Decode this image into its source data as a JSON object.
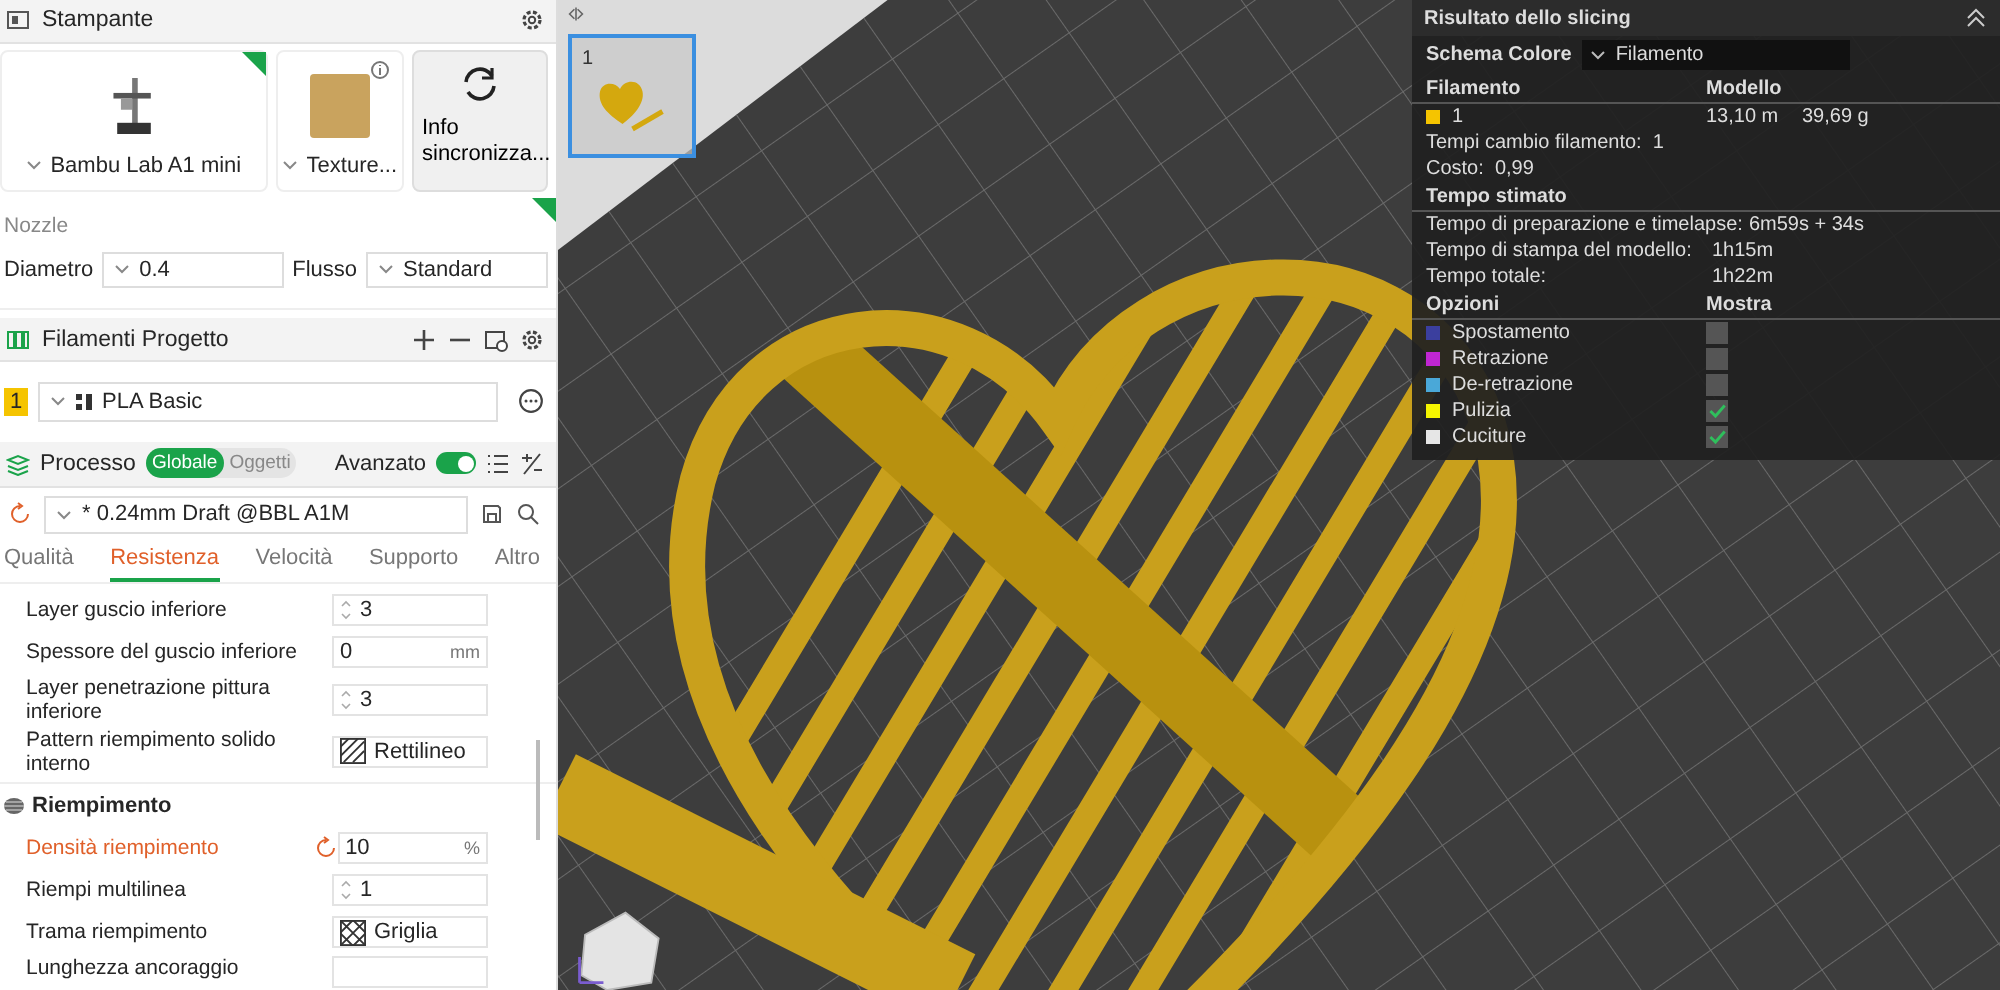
{
  "printer": {
    "title": "Stampante",
    "synced": true,
    "model": "Bambu Lab A1 mini",
    "plate": "Texture...",
    "sync_button": "Info sincronizza..."
  },
  "nozzle": {
    "title": "Nozzle",
    "synced": true,
    "diameter_label": "Diametro",
    "diameter": "0.4",
    "flow_label": "Flusso",
    "flow": "Standard"
  },
  "filaments": {
    "title": "Filamenti Progetto",
    "items": [
      {
        "index": "1",
        "color": "#f5c400",
        "name": "PLA Basic"
      }
    ]
  },
  "process": {
    "title": "Processo",
    "scopes": [
      {
        "label": "Globale",
        "selected": true
      },
      {
        "label": "Oggetti",
        "selected": false
      }
    ],
    "advanced_label": "Avanzato",
    "advanced_on": true,
    "preset": "* 0.24mm Draft @BBL A1M",
    "tabs": [
      {
        "label": "Qualità",
        "selected": false
      },
      {
        "label": "Resistenza",
        "selected": true
      },
      {
        "label": "Velocità",
        "selected": false
      },
      {
        "label": "Supporto",
        "selected": false
      },
      {
        "label": "Altro",
        "selected": false
      }
    ],
    "settings": [
      {
        "kind": "spin",
        "label": "Layer guscio inferiore",
        "value": "3",
        "modified": false
      },
      {
        "kind": "unit",
        "label": "Spessore del guscio inferiore",
        "value": "0",
        "unit": "mm",
        "modified": false
      },
      {
        "kind": "spin",
        "label": "Layer penetrazione pittura inferiore",
        "value": "3",
        "modified": false
      },
      {
        "kind": "lines",
        "label": "Pattern riempimento solido interno",
        "value": "Rettilineo",
        "modified": false
      },
      {
        "kind": "section",
        "label": "Riempimento"
      },
      {
        "kind": "unit",
        "label": "Densità riempimento",
        "value": "10",
        "unit": "%",
        "modified": true
      },
      {
        "kind": "spin",
        "label": "Riempi multilinea",
        "value": "1",
        "modified": false
      },
      {
        "kind": "grid",
        "label": "Trama riempimento",
        "value": "Griglia",
        "modified": false
      },
      {
        "kind": "empty",
        "label": "Lunghezza ancoraggio",
        "modified": false
      }
    ]
  },
  "viewport": {
    "plate_label": "1"
  },
  "slicing_result": {
    "title": "Risultato dello slicing",
    "color_scheme_label": "Schema Colore",
    "color_scheme": "Filamento",
    "columns": [
      "Filamento",
      "Modello"
    ],
    "filaments": [
      {
        "name": "1",
        "color": "#f5c400",
        "length": "13,10 m",
        "weight": "39,69 g"
      }
    ],
    "changes": "Tempi cambio filamento:  1",
    "cost": "Costo:  0,99",
    "time_title": "Tempo stimato",
    "times": [
      {
        "label": "Tempo di preparazione e timelapse:",
        "value": "6m59s + 34s"
      },
      {
        "label": "Tempo di stampa del modello:",
        "value": "1h15m"
      },
      {
        "label": "Tempo totale:",
        "value": "1h22m"
      }
    ],
    "option_columns": [
      "Opzioni",
      "Mostra"
    ],
    "options": [
      {
        "label": "Spostamento",
        "color": "#3b3f9e",
        "shown": false
      },
      {
        "label": "Retrazione",
        "color": "#c026d3",
        "shown": false
      },
      {
        "label": "De-retrazione",
        "color": "#4aa8d8",
        "shown": false
      },
      {
        "label": "Pulizia",
        "color": "#f5f500",
        "shown": true
      },
      {
        "label": "Cuciture",
        "color": "#e6e6e6",
        "shown": true
      }
    ]
  }
}
